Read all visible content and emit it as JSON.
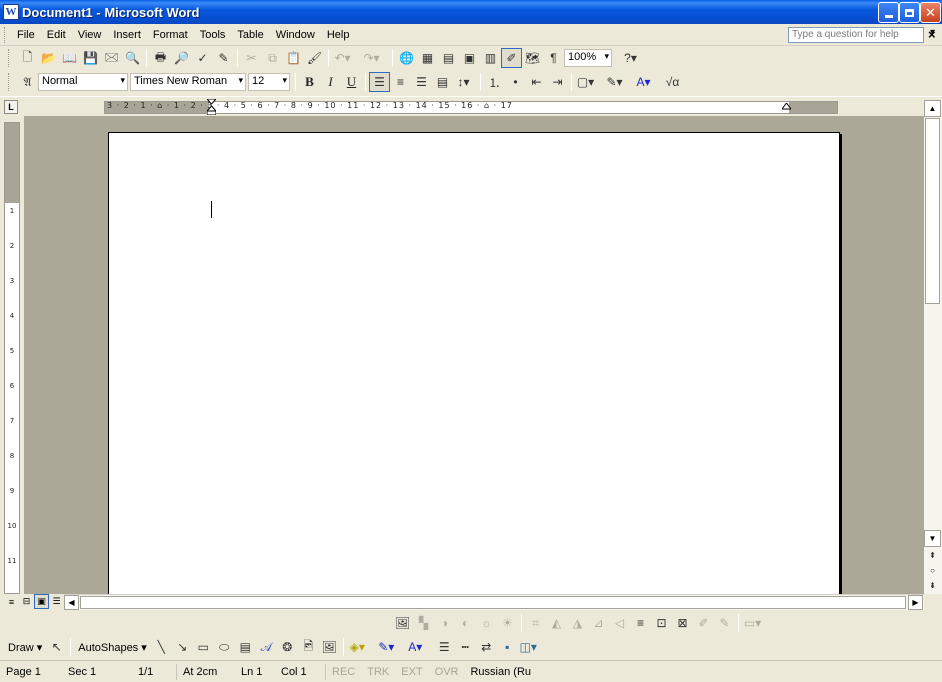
{
  "window": {
    "title": "Document1 - Microsoft Word",
    "app_icon": "W"
  },
  "menu": {
    "items": [
      "File",
      "Edit",
      "View",
      "Insert",
      "Format",
      "Tools",
      "Table",
      "Window",
      "Help"
    ],
    "help_placeholder": "Type a question for help",
    "doc_close": "×"
  },
  "standard_toolbar": {
    "zoom": "100%"
  },
  "formatting_toolbar": {
    "style": "Normal",
    "font": "Times New Roman",
    "size": "12"
  },
  "ruler": {
    "h_numbers": "3 · 2 · 1 · ⌂ · 1 · 2 · 3 · 4 · 5 · 6 · 7 · 8 · 9 · 10 · 11 · 12 · 13 · 14 · 15 · 16 · ⌂ · 17",
    "v_numbers": [
      "1",
      "2",
      "3",
      "4",
      "5",
      "6",
      "7",
      "8",
      "9",
      "10",
      "11"
    ],
    "tab_selector": "L"
  },
  "drawing_toolbar": {
    "draw_label": "Draw ▾",
    "autoshapes_label": "AutoShapes ▾"
  },
  "status": {
    "page": "Page 1",
    "sec": "Sec 1",
    "pages": "1/1",
    "at": "At 2cm",
    "ln": "Ln 1",
    "col": "Col 1",
    "rec": "REC",
    "trk": "TRK",
    "ext": "EXT",
    "ovr": "OVR",
    "language": "Russian (Ru"
  },
  "colors": {
    "titlebar": "#0858dc",
    "workspace": "#aba897",
    "chrome": "#ece9d8"
  }
}
